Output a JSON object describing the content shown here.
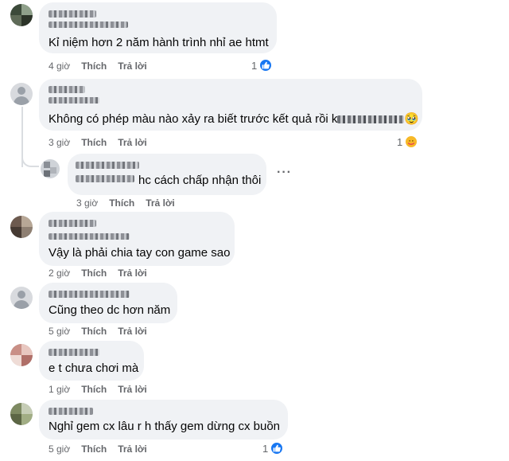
{
  "comments": [
    {
      "text": "Kỉ niệm hơn 2 năm hành trình nhỉ ae htmt",
      "time": "4 giờ",
      "like": "Thích",
      "reply": "Trả lời",
      "reaction_count": "1",
      "reaction": "like"
    },
    {
      "text": "Không có phép màu nào xảy ra biết trước kết quả rồi k",
      "emoji": "🥹",
      "time": "3 giờ",
      "like": "Thích",
      "reply": "Trả lời",
      "reaction_count": "1",
      "reaction": "care"
    },
    {
      "text": "hc cách chấp nhận thôi",
      "time": "3 giờ",
      "like": "Thích",
      "reply": "Trả lời",
      "is_reply": true,
      "more": "···"
    },
    {
      "text": "Vậy là phải chia tay con game sao",
      "time": "2 giờ",
      "like": "Thích",
      "reply": "Trả lời"
    },
    {
      "text": "Cũng theo dc hơn năm",
      "time": "5 giờ",
      "like": "Thích",
      "reply": "Trả lời"
    },
    {
      "text": "e t chưa chơi mà",
      "time": "1 giờ",
      "like": "Thích",
      "reply": "Trả lời"
    },
    {
      "text": "Nghỉ gem cx lâu r h thấy gem dừng cx buồn",
      "time": "5 giờ",
      "like": "Thích",
      "reply": "Trả lời",
      "reaction_count": "1",
      "reaction": "like"
    }
  ],
  "colors": {
    "bubble": "#f0f2f5",
    "meta": "#65676b",
    "like": "#1877f2",
    "care": "#f7b928"
  },
  "icons": {
    "like": "thumbs-up-icon",
    "care": "care-face-icon",
    "more": "more-options-icon"
  }
}
